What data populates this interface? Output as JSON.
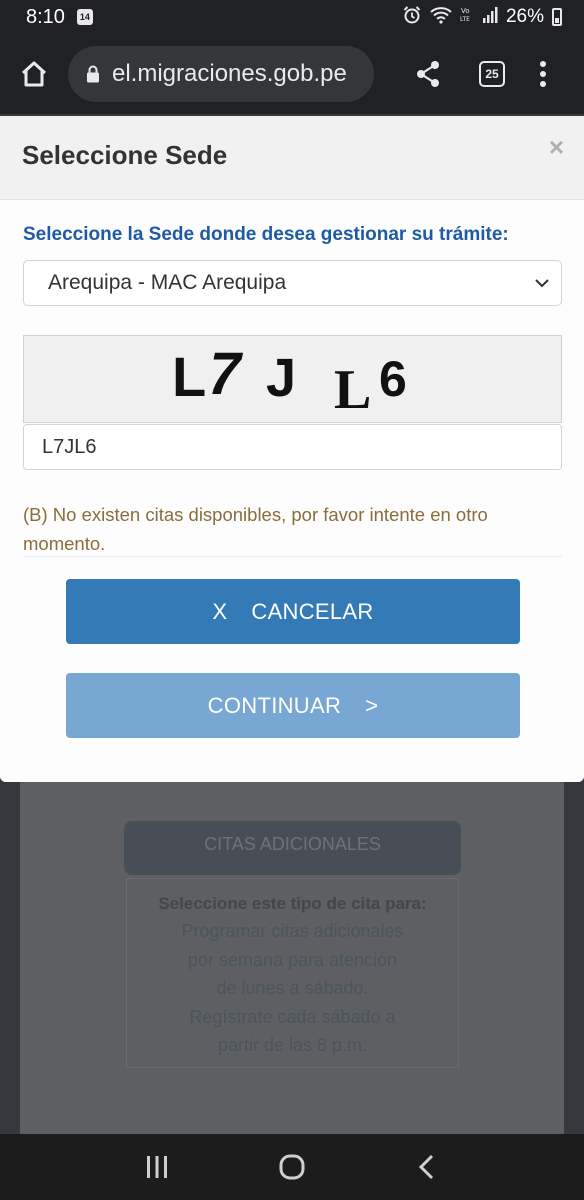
{
  "status_bar": {
    "time": "8:10",
    "calendar_badge": "14",
    "battery": "26%",
    "icons": [
      "alarm-icon",
      "wifi-icon",
      "volte-icon",
      "signal-icon",
      "battery-icon"
    ]
  },
  "browser": {
    "url": "el.migraciones.gob.pe",
    "tab_count": "25"
  },
  "modal": {
    "title": "Seleccione Sede",
    "close": "×",
    "sede_label": "Seleccione la Sede donde desea gestionar su trámite:",
    "sede_selected": "Arequipa - MAC Arequipa",
    "captcha_image_text": "L7J L6",
    "captcha_value": "L7JL6",
    "message": "(B) No existen citas disponibles, por favor intente en otro momento.",
    "cancel_icon": "X",
    "cancel_label": "CANCELAR",
    "continue_label": "CONTINUAR",
    "continue_icon": ">"
  },
  "background": {
    "citas_button": "CITAS ADICIONALES",
    "card_title": "Seleccione este tipo de cita para:",
    "card_desc": "Programar citas adicionales por semana para atención de lunes a sábado. Regístrate cada sábado a partir de las 8 p.m."
  },
  "colors": {
    "primary": "#337ab7",
    "primary_disabled": "#77a7d2",
    "label_blue": "#1e5aa5",
    "warning_text": "#8a6d3b",
    "chrome_dark": "#202124"
  }
}
